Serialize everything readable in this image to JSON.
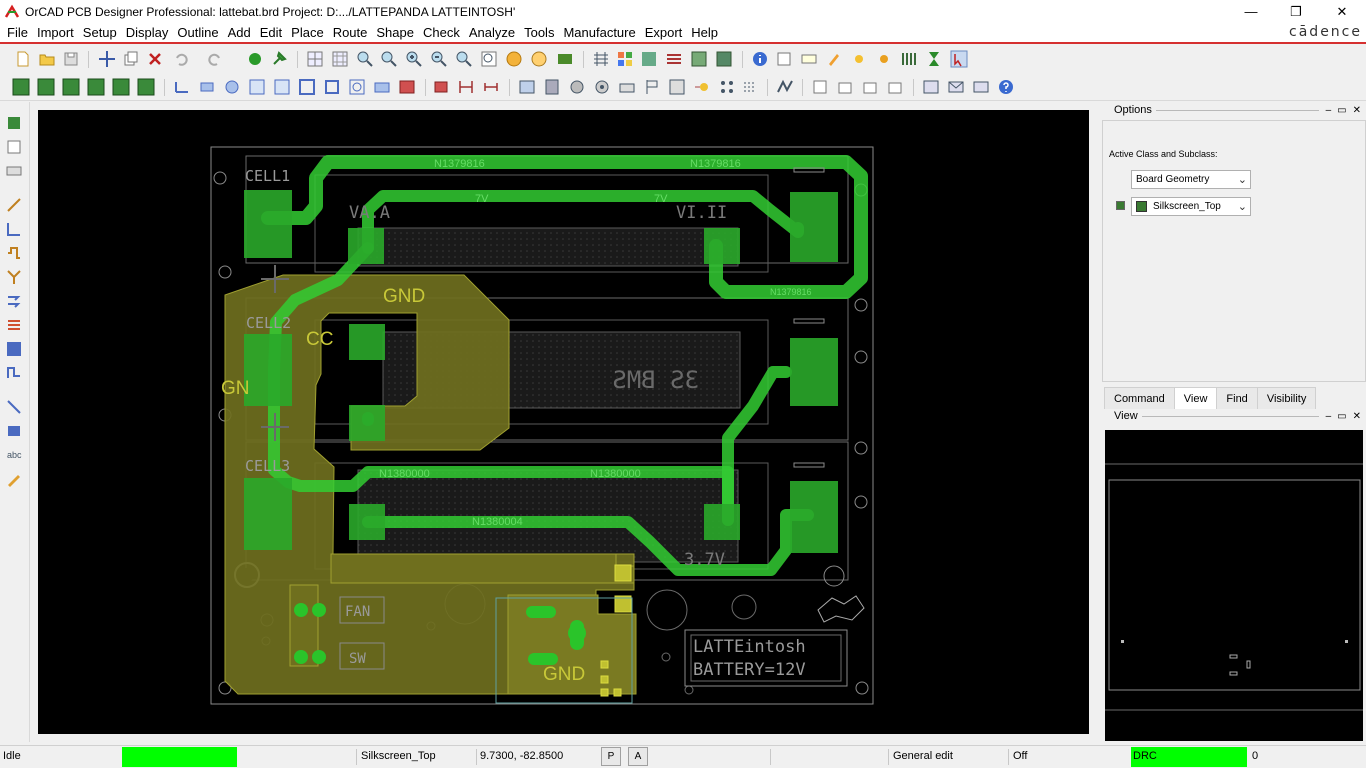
{
  "window": {
    "title": "OrCAD PCB Designer Professional: lattebat.brd  Project: D:.../LATTEPANDA LATTEINTOSH'",
    "minimize": "—",
    "restore": "❐",
    "close": "✕"
  },
  "menu": {
    "items": [
      "File",
      "Import",
      "Setup",
      "Display",
      "Outline",
      "Add",
      "Edit",
      "Place",
      "Route",
      "Shape",
      "Check",
      "Analyze",
      "Tools",
      "Manufacture",
      "Export",
      "Help"
    ],
    "brand": "cādence"
  },
  "board": {
    "nets": {
      "n1379816_a": "N1379816",
      "n1379816_b": "N1379816",
      "n1379816_c": "N1379816",
      "n1380000_a": "N1380000",
      "n1380000_b": "N1380000",
      "n1380004": "N1380004",
      "v7_a": "7V",
      "v7_b": "7V"
    },
    "silk": {
      "cell1": "CELL1",
      "cell2": "CELL2",
      "cell3": "CELL3",
      "bms": "3S BMS",
      "fan": "FAN",
      "sw": "SW",
      "logo_line1": "LATTEintosh",
      "logo_line2": "BATTERY=12V",
      "v111": "VI.II",
      "v111b": "VA.A",
      "v37": "3.7V"
    },
    "shape_labels": {
      "gnd_top": "GND",
      "gnd_left": "GN",
      "gnd_bottom": "GND",
      "cc": "CC"
    }
  },
  "panel": {
    "options_title": "Options",
    "active_class_label": "Active Class and Subclass:",
    "class_value": "Board Geometry",
    "subclass_value": "Silkscreen_Top",
    "tabs": [
      "Command",
      "View",
      "Find",
      "Visibility"
    ],
    "active_tab": "View",
    "view_title": "View",
    "colors": {
      "subclass_swatch": "#3a7a32"
    }
  },
  "status": {
    "state": "Idle",
    "subclass": "Silkscreen_Top",
    "coords": "9.7300, -82.8500",
    "btn_p": "P",
    "btn_a": "A",
    "mode": "General edit",
    "off": "Off",
    "drc": "DRC",
    "drc_count": "0"
  },
  "colors": {
    "canvas": "#000000",
    "copper": "#1f8f1f",
    "trace": "#33cc33",
    "shape": "#9a9a2a",
    "outline": "#8a8a8a",
    "status_green": "#00ff00"
  }
}
